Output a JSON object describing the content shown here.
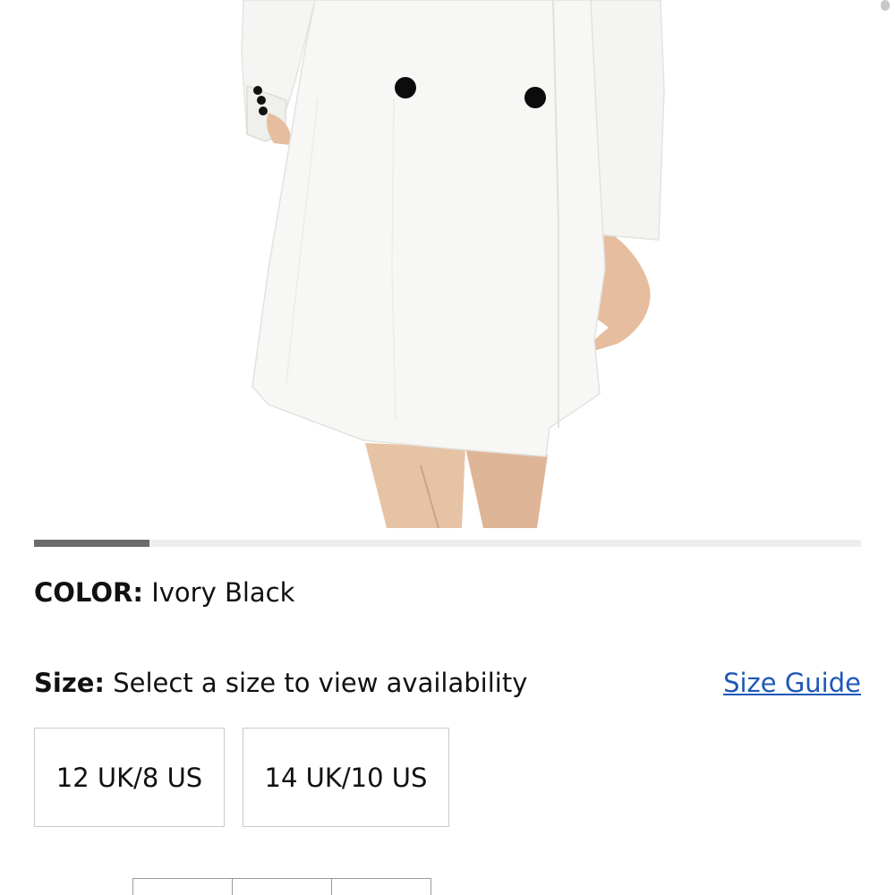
{
  "product": {
    "image": {
      "alt": ""
    }
  },
  "carousel": {
    "progress": 0.14
  },
  "color": {
    "label": "COLOR:",
    "value": "Ivory Black"
  },
  "size": {
    "label": "Size:",
    "hint": "Select a size to view availability",
    "guide_link": "Size Guide",
    "options": [
      {
        "label": "12 UK/8 US"
      },
      {
        "label": "14 UK/10 US"
      }
    ]
  },
  "colors": {
    "link": "#1f57b8",
    "track": "#eeeeee",
    "thumb": "#6b6b6b",
    "border": "#c9c9c9"
  }
}
